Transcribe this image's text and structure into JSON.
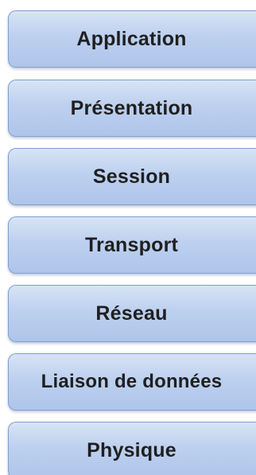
{
  "layers": [
    {
      "label": "Application"
    },
    {
      "label": "Présentation"
    },
    {
      "label": "Session"
    },
    {
      "label": "Transport"
    },
    {
      "label": "Réseau"
    },
    {
      "label": "Liaison de données"
    },
    {
      "label": "Physique"
    }
  ],
  "colors": {
    "box_fill_top": "#d8e4f6",
    "box_fill_bottom": "#aec5ea",
    "box_border": "#7f9fcf",
    "text": "#1f1f1f"
  }
}
